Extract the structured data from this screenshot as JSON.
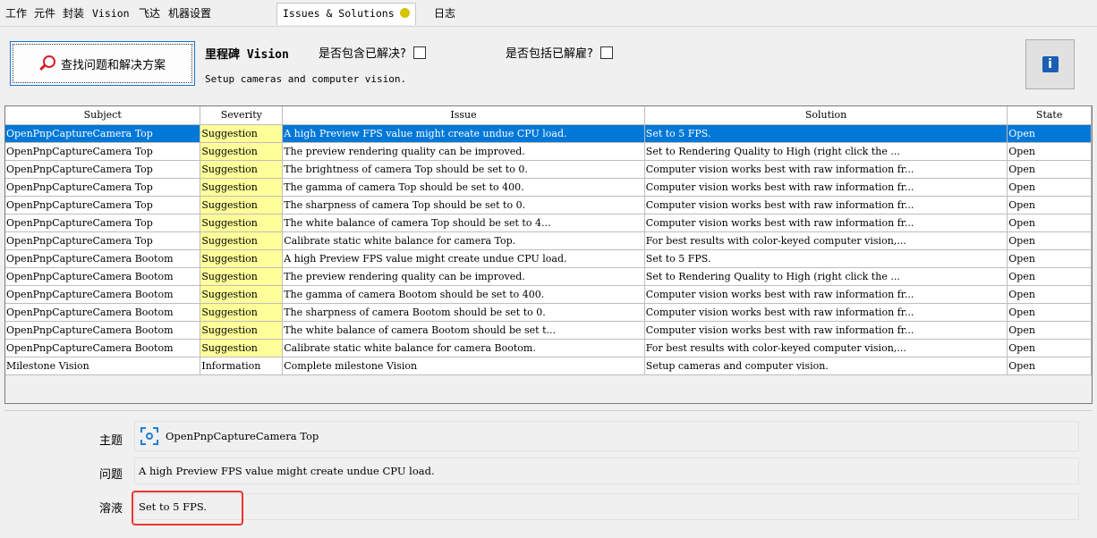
{
  "tabs": [
    {
      "label": "工作"
    },
    {
      "label": "元件"
    },
    {
      "label": "封装"
    },
    {
      "label": "Vision"
    },
    {
      "label": "飞达"
    },
    {
      "label": "机器设置"
    },
    {
      "label": "Issues & Solutions"
    },
    {
      "label": "日志"
    }
  ],
  "active_tab_status_color": "#d4c400",
  "toolbar": {
    "find_button_label": "查找问题和解决方案",
    "find_button_icon": "search-icon",
    "milestone_prefix": "里程碑",
    "milestone_name": "Vision",
    "milestone_description": "Setup cameras and computer vision.",
    "include_solved_label": "是否包含已解决?",
    "include_dismissed_label": "是否包括已解雇?",
    "info_icon": "info-icon"
  },
  "table": {
    "columns": [
      "Subject",
      "Severity",
      "Issue",
      "Solution",
      "State"
    ],
    "rows": [
      {
        "subject": "OpenPnpCaptureCamera Top",
        "severity": "Suggestion",
        "issue": "A high Preview FPS value might create undue CPU load.",
        "solution": "Set to 5 FPS.",
        "state": "Open"
      },
      {
        "subject": "OpenPnpCaptureCamera Top",
        "severity": "Suggestion",
        "issue": "The preview rendering quality can be improved.",
        "solution": "Set to Rendering Quality to High (right click the ...",
        "state": "Open"
      },
      {
        "subject": "OpenPnpCaptureCamera Top",
        "severity": "Suggestion",
        "issue": "The brightness of camera Top should be set to 0.",
        "solution": "Computer vision works best with raw information fr...",
        "state": "Open"
      },
      {
        "subject": "OpenPnpCaptureCamera Top",
        "severity": "Suggestion",
        "issue": "The gamma of camera Top should be set to 400.",
        "solution": "Computer vision works best with raw information fr...",
        "state": "Open"
      },
      {
        "subject": "OpenPnpCaptureCamera Top",
        "severity": "Suggestion",
        "issue": "The sharpness of camera Top should be set to 0.",
        "solution": "Computer vision works best with raw information fr...",
        "state": "Open"
      },
      {
        "subject": "OpenPnpCaptureCamera Top",
        "severity": "Suggestion",
        "issue": "The white balance of camera Top should be set to 4...",
        "solution": "Computer vision works best with raw information fr...",
        "state": "Open"
      },
      {
        "subject": "OpenPnpCaptureCamera Top",
        "severity": "Suggestion",
        "issue": "Calibrate static white balance for camera Top.",
        "solution": "For best results with color-keyed computer vision,...",
        "state": "Open"
      },
      {
        "subject": "OpenPnpCaptureCamera Bootom",
        "severity": "Suggestion",
        "issue": "A high Preview FPS value might create undue CPU load.",
        "solution": "Set to 5 FPS.",
        "state": "Open"
      },
      {
        "subject": "OpenPnpCaptureCamera Bootom",
        "severity": "Suggestion",
        "issue": "The preview rendering quality can be improved.",
        "solution": "Set to Rendering Quality to High (right click the ...",
        "state": "Open"
      },
      {
        "subject": "OpenPnpCaptureCamera Bootom",
        "severity": "Suggestion",
        "issue": "The gamma of camera Bootom should be set to 400.",
        "solution": "Computer vision works best with raw information fr...",
        "state": "Open"
      },
      {
        "subject": "OpenPnpCaptureCamera Bootom",
        "severity": "Suggestion",
        "issue": "The sharpness of camera Bootom should be set to 0.",
        "solution": "Computer vision works best with raw information fr...",
        "state": "Open"
      },
      {
        "subject": "OpenPnpCaptureCamera Bootom",
        "severity": "Suggestion",
        "issue": "The white balance of camera Bootom should be set t...",
        "solution": "Computer vision works best with raw information fr...",
        "state": "Open"
      },
      {
        "subject": "OpenPnpCaptureCamera Bootom",
        "severity": "Suggestion",
        "issue": "Calibrate static white balance for camera Bootom.",
        "solution": "For best results with color-keyed computer vision,...",
        "state": "Open"
      },
      {
        "subject": "Milestone Vision",
        "severity": "Information",
        "issue": "Complete milestone Vision",
        "solution": "Setup cameras and computer vision.",
        "state": "Open"
      }
    ],
    "selected_row": 0,
    "suggestion_color": "#ffff99",
    "selection_color": "#0078d7"
  },
  "details": {
    "subject_label": "主题",
    "subject_icon": "camera-icon",
    "subject_value": "OpenPnpCaptureCamera Top",
    "issue_label": "问题",
    "issue_value": "A high Preview FPS value might create undue CPU load.",
    "solution_label": "溶液",
    "solution_value": "Set to 5 FPS."
  }
}
